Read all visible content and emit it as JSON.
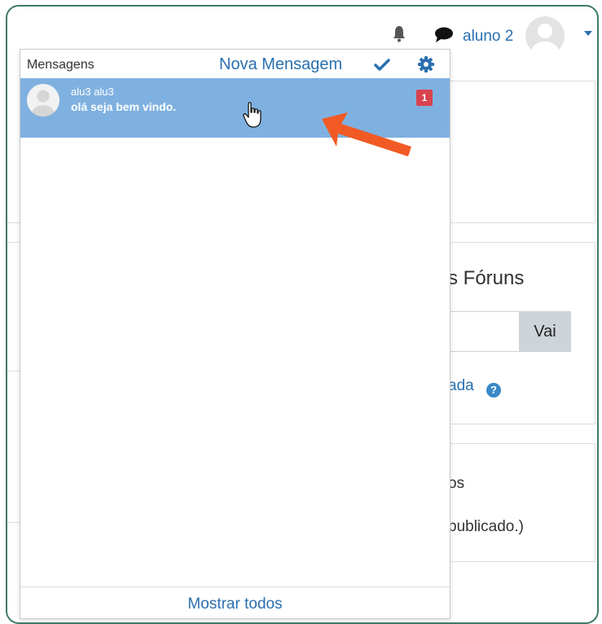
{
  "nav": {
    "username": "aluno 2",
    "icons": [
      "bell-icon",
      "chat-icon",
      "avatar",
      "caret-down-icon"
    ]
  },
  "background": {
    "forums_heading": "s Fóruns",
    "search_button": "Vai",
    "advanced_link": "ada",
    "section_text": "os",
    "published_text": "publicado.)"
  },
  "popover": {
    "title": "Mensagens",
    "new_message": "Nova Mensagem",
    "messages": [
      {
        "sender": "alu3 alu3",
        "preview": "olá seja bem vindo.",
        "unread": "1"
      }
    ],
    "footer": "Mostrar todos"
  },
  "colors": {
    "accent": "#2a6fb0",
    "selected_row": "#7fb1e0",
    "badge": "#d9434e",
    "annotation_arrow": "#f15a24",
    "frame_border": "#3f7a6a"
  }
}
